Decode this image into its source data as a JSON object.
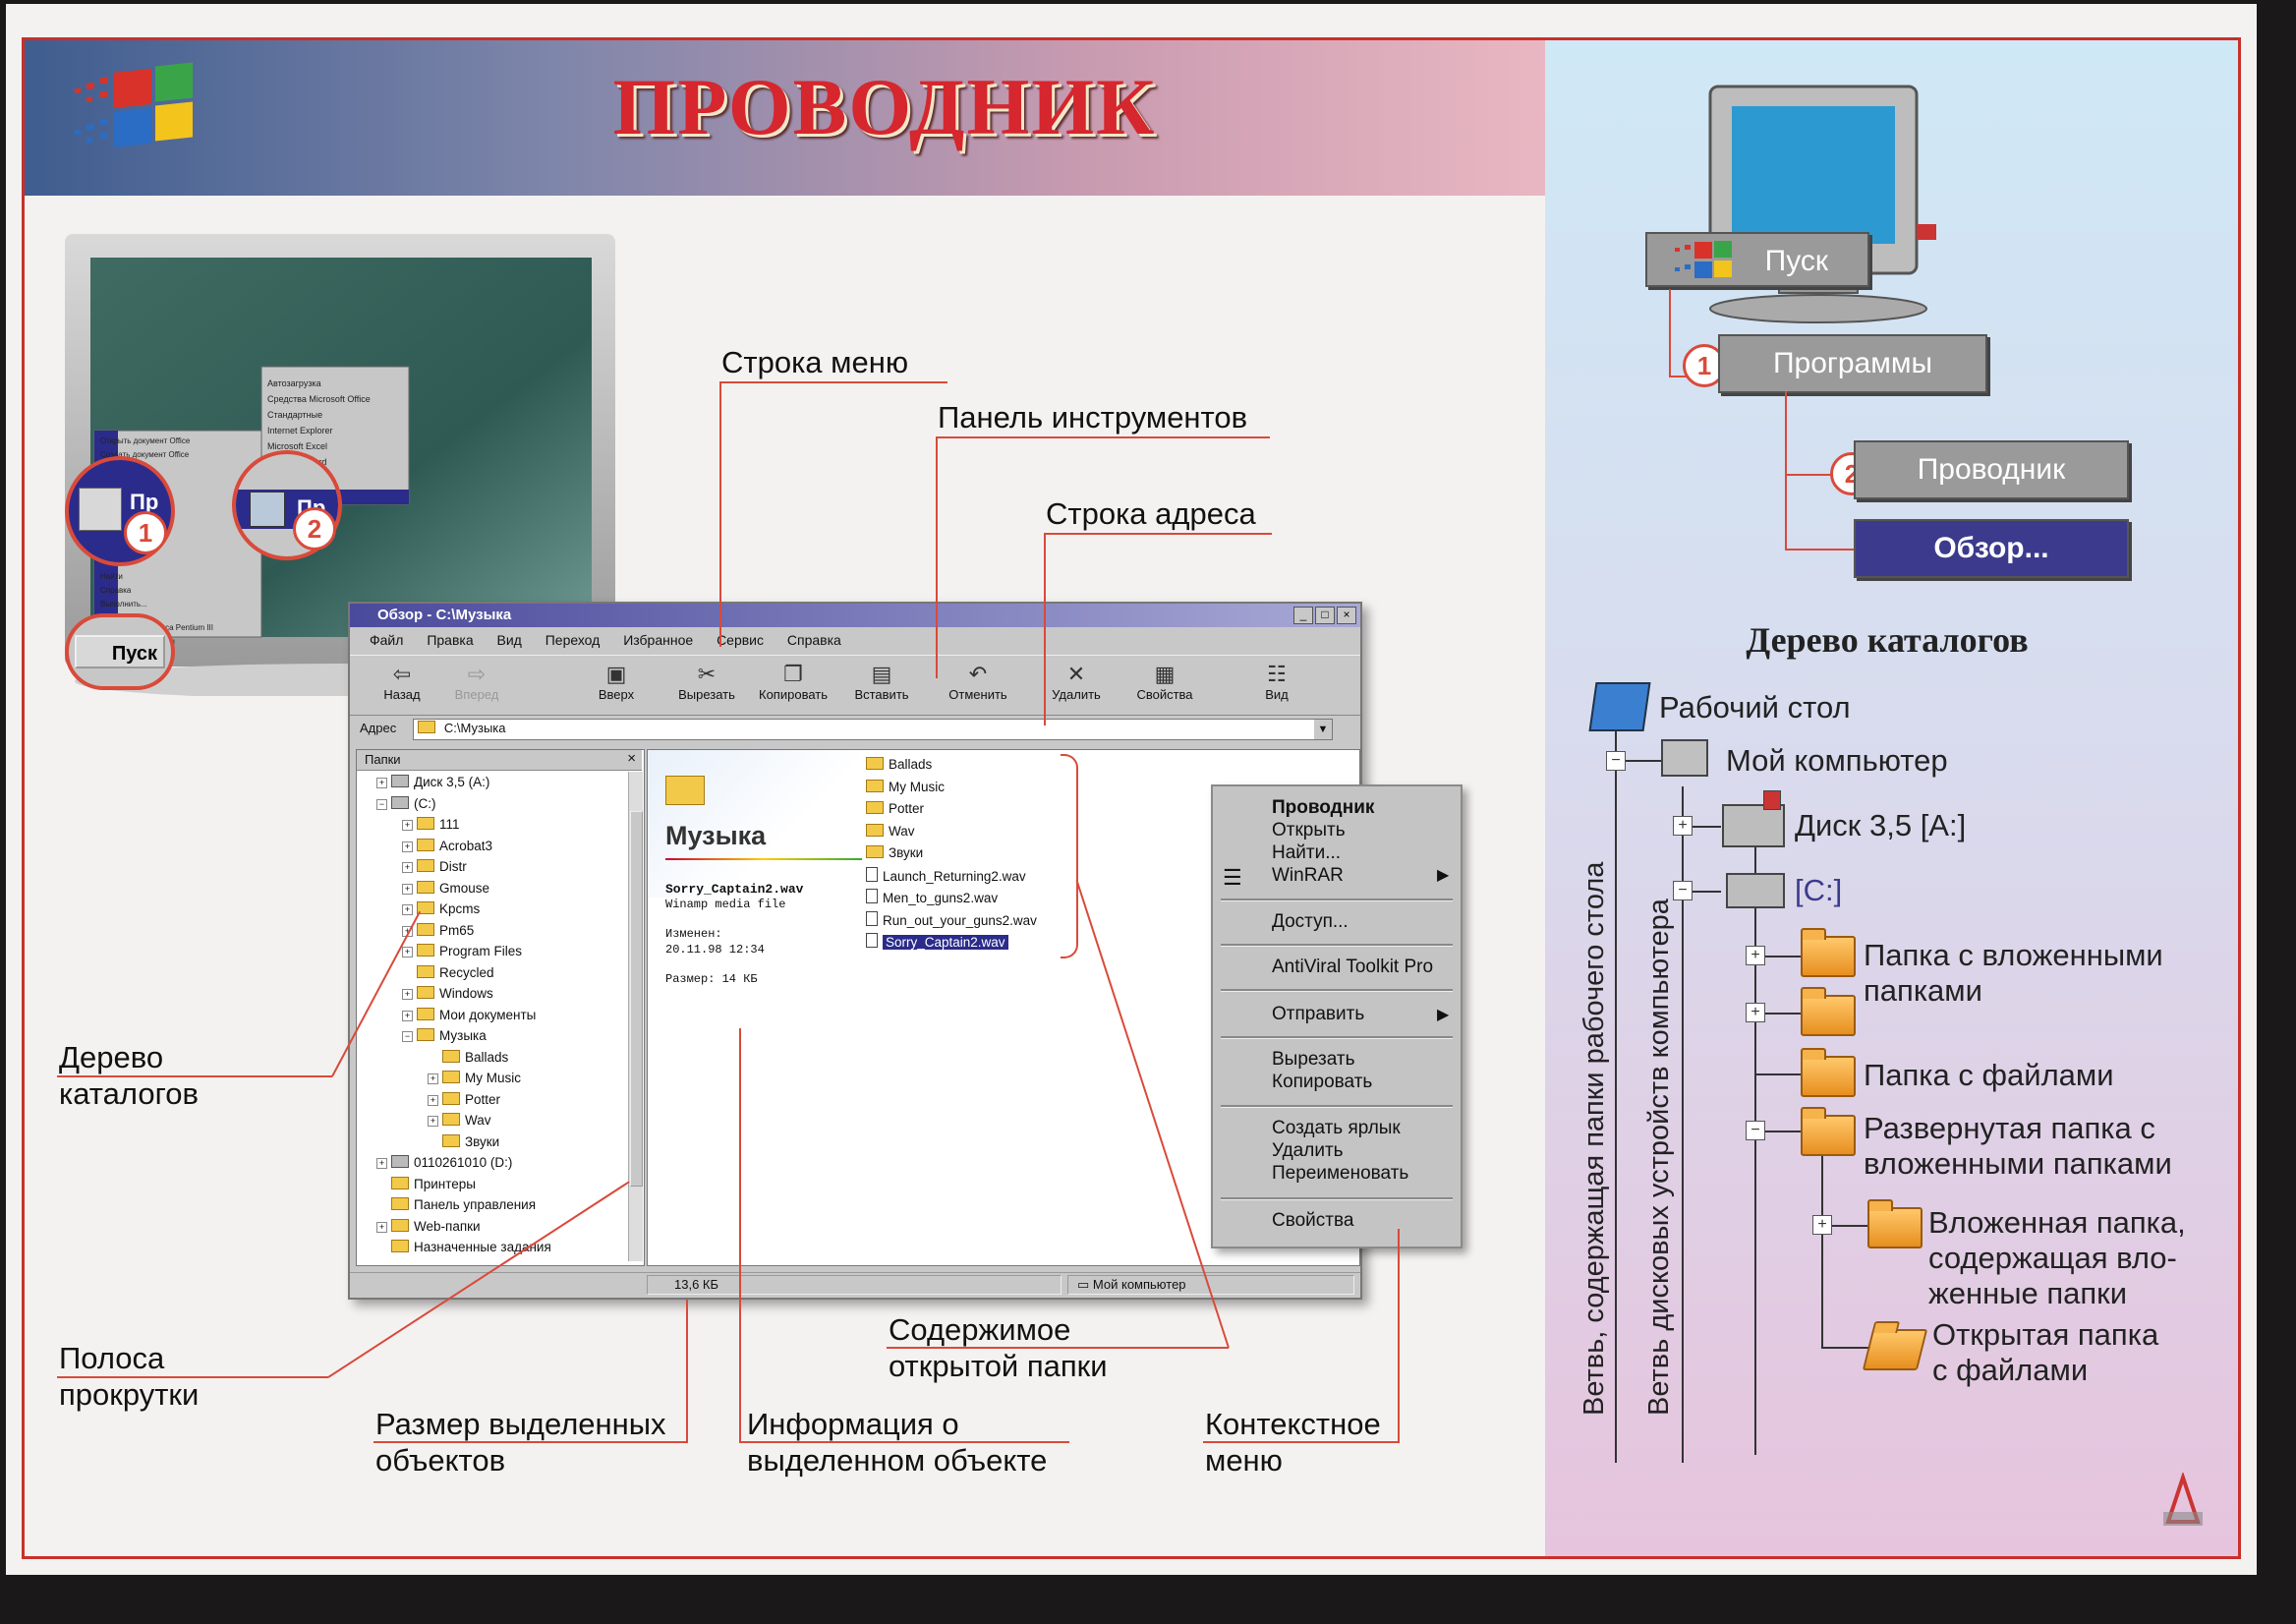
{
  "poster": {
    "title": "ПРОВОДНИК",
    "colors": {
      "frame": "#c8302a",
      "title": "#d6262e",
      "callout_line": "#d94a3a"
    }
  },
  "callouts": {
    "menu_bar": "Строка меню",
    "toolbar": "Панель инструментов",
    "address_bar": "Строка адреса",
    "tree_line1": "Дерево",
    "tree_line2": "каталогов",
    "scroll_line1": "Полоса",
    "scroll_line2": "прокрутки",
    "size_line1": "Размер выделенных",
    "size_line2": "объектов",
    "info_line1": "Информация о",
    "info_line2": "выделенном объекте",
    "contents_line1": "Содержимое",
    "contents_line2": "открытой папки",
    "context_line1": "Контекстное",
    "context_line2": "меню"
  },
  "left_monitor": {
    "start_label": "Пуск",
    "badge1": "1",
    "badge2": "2",
    "programs_short": "Пр",
    "submenu_items": [
      "Автозагрузка",
      "Средства Microsoft Office",
      "Стандартные",
      "Internet Explorer",
      "Microsoft Excel",
      "Microsoft Word",
      "Проводник"
    ],
    "start_items": [
      "Открыть документ Office",
      "Создать документ Office",
      "Найти",
      "Справка",
      "Выполнить...",
      "Завершение сеанса Pentium III",
      "Завершение работы"
    ]
  },
  "explorer": {
    "title": "Обзор - C:\\Музыка",
    "menu": [
      "Файл",
      "Правка",
      "Вид",
      "Переход",
      "Избранное",
      "Сервис",
      "Справка"
    ],
    "toolbar": [
      "Назад",
      "Вперед",
      "Вверх",
      "Вырезать",
      "Копировать",
      "Вставить",
      "Отменить",
      "Удалить",
      "Свойства",
      "Вид"
    ],
    "address_label": "Адрес",
    "address_value": "C:\\Музыка",
    "folders_label": "Папки",
    "tree": [
      "Диск 3,5 (A:)",
      "(C:)",
      "111",
      "Acrobat3",
      "Distr",
      "Gmouse",
      "Kpcms",
      "Pm65",
      "Program Files",
      "Recycled",
      "Windows",
      "Мои документы",
      "Музыка",
      "Ballads",
      "My Music",
      "Potter",
      "Wav",
      "Звуки",
      "0110261010 (D:)",
      "Принтеры",
      "Панель управления",
      "Web-папки",
      "Назначенные задания"
    ],
    "folder_name": "Музыка",
    "selected_file": "Sorry_Captain2.wav",
    "file_type": "Winamp media file",
    "modified_label": "Изменен:",
    "modified_value": "20.11.98 12:34",
    "size_label": "Размер: 14 КБ",
    "files": [
      "Ballads",
      "My Music",
      "Potter",
      "Wav",
      "Звуки",
      "Launch_Returning2.wav",
      "Men_to_guns2.wav",
      "Run_out_your_guns2.wav",
      "Sorry_Captain2.wav"
    ],
    "status_size": "13,6 КБ",
    "status_location": "Мой компьютер"
  },
  "context_menu": {
    "items": [
      "Проводник",
      "Открыть",
      "Найти...",
      "WinRAR",
      "Доступ...",
      "AntiViral Toolkit Pro",
      "Отправить",
      "Вырезать",
      "Копировать",
      "Создать ярлык",
      "Удалить",
      "Переименовать",
      "Свойства"
    ]
  },
  "right_panel": {
    "start": "Пуск",
    "programs": "Программы",
    "explorer": "Проводник",
    "browse": "Обзор...",
    "badge1": "1",
    "badge2": "2",
    "tree_title": "Дерево каталогов",
    "desktop": "Рабочий стол",
    "my_computer": "Мой компьютер",
    "floppy": "Диск 3,5 [A:]",
    "drive_c": "[C:]",
    "nested_folders_1": "Папка с вложенными",
    "nested_folders_2": "папками",
    "files_folder": "Папка с файлами",
    "expanded_1": "Развернутая папка с",
    "expanded_2": "вложенными папками",
    "nested_1": "Вложенная папка,",
    "nested_2": "содержащая вло-",
    "nested_3": "женные папки",
    "open_1": "Открытая папка",
    "open_2": "с файлами",
    "vertical_desktop": "Ветвь, содержащая папки рабочего стола",
    "vertical_drives": "Ветвь дисковых устройств компьютера"
  }
}
